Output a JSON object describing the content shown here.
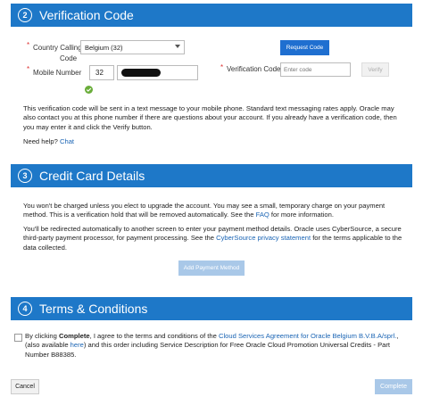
{
  "sections": [
    {
      "number": "2",
      "title": "Verification Code"
    },
    {
      "number": "3",
      "title": "Credit Card Details"
    },
    {
      "number": "4",
      "title": "Terms & Conditions"
    }
  ],
  "verification": {
    "country_label_1": "Country Calling",
    "country_label_2": "Code",
    "country_value": "Belgium (32)",
    "mobile_label": "Mobile Number",
    "country_code": "32",
    "request_code_label": "Request Code",
    "code_label": "Verification Code",
    "code_placeholder": "Enter code",
    "verify_label": "Verify",
    "info_text": "This verification code will be sent in a text message to your mobile phone. Standard text messaging rates apply. Oracle may also contact you at this phone number if there are questions about your account. If you already have a verification code, then you may enter it and click the Verify button.",
    "help_prefix": "Need help?",
    "help_link": "Chat"
  },
  "credit_card": {
    "p1_before": "You won't be charged unless you elect to upgrade the account. You may see a small, temporary charge on your payment method. This is a verification hold that will be removed automatically. See the",
    "p1_link": "FAQ",
    "p1_after": "for more information.",
    "p2_before": "You'll be redirected automatically to another screen to enter your payment method details. Oracle uses CyberSource, a secure third-party payment processor, for payment processing. See the",
    "p2_link": "CyberSource privacy statement",
    "p2_after": "for the terms applicable to the data collected.",
    "add_payment_label": "Add Payment Method"
  },
  "terms": {
    "t_before": "By clicking",
    "t_bold": "Complete",
    "t_mid": ", I agree to the terms and conditions of the",
    "t_link1": "Cloud Services Agreement for Oracle Belgium B.V.B.A/sprl.",
    "t_mid2": ", (also available",
    "t_link2": "here",
    "t_after": ") and this order including Service Description for Free Oracle Cloud Promotion Universal Credits - Part Number B88385."
  },
  "footer": {
    "cancel_label": "Cancel",
    "complete_label": "Complete"
  },
  "colors": {
    "band": "#1e78c8",
    "primary_button": "#1f6fd0",
    "disabled_button": "#a9c8e8",
    "link": "#1a64b4",
    "success": "#6aad3a"
  }
}
